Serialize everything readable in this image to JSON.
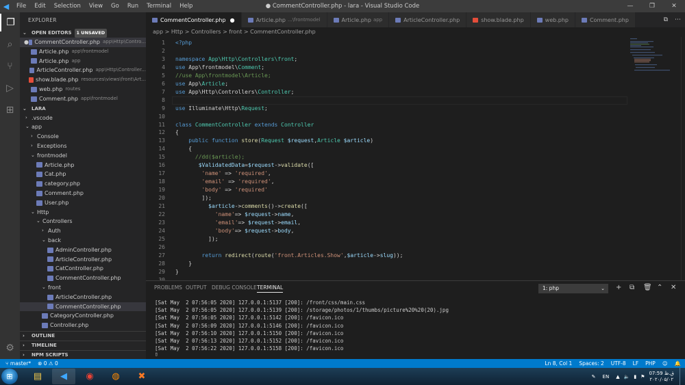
{
  "window": {
    "title": "● CommentController.php - lara - Visual Studio Code",
    "menu": [
      "File",
      "Edit",
      "Selection",
      "View",
      "Go",
      "Run",
      "Terminal",
      "Help"
    ],
    "controls": [
      "—",
      "❐",
      "✕"
    ]
  },
  "sidebar": {
    "header": "EXPLORER",
    "open_editors": {
      "label": "OPEN EDITORS",
      "badge": "1 UNSAVED",
      "items": [
        {
          "name": "CommentController.php",
          "desc": "app\\Http\\Contro...",
          "dirty": true
        },
        {
          "name": "Article.php",
          "desc": "app\\frontmodel"
        },
        {
          "name": "Article.php",
          "desc": "app"
        },
        {
          "name": "ArticleController.php",
          "desc": "app\\Http\\Controller..."
        },
        {
          "name": "show.blade.php",
          "desc": "resources\\views\\front\\Art..."
        },
        {
          "name": "web.php",
          "desc": "routes"
        },
        {
          "name": "Comment.php",
          "desc": "app\\frontmodel"
        }
      ]
    },
    "project": {
      "label": "LARA",
      "tree": [
        {
          "name": ".vscode",
          "depth": 1,
          "type": "folder",
          "open": false
        },
        {
          "name": "app",
          "depth": 1,
          "type": "folder",
          "open": true
        },
        {
          "name": "Console",
          "depth": 2,
          "type": "folder",
          "open": false
        },
        {
          "name": "Exceptions",
          "depth": 2,
          "type": "folder",
          "open": false
        },
        {
          "name": "frontmodel",
          "depth": 2,
          "type": "folder",
          "open": true
        },
        {
          "name": "Article.php",
          "depth": 3,
          "type": "php"
        },
        {
          "name": "Cat.php",
          "depth": 3,
          "type": "php"
        },
        {
          "name": "category.php",
          "depth": 3,
          "type": "php"
        },
        {
          "name": "Comment.php",
          "depth": 3,
          "type": "php"
        },
        {
          "name": "User.php",
          "depth": 3,
          "type": "php"
        },
        {
          "name": "Http",
          "depth": 2,
          "type": "folder",
          "open": true
        },
        {
          "name": "Controllers",
          "depth": 3,
          "type": "folder",
          "open": true
        },
        {
          "name": "Auth",
          "depth": 4,
          "type": "folder",
          "open": false
        },
        {
          "name": "back",
          "depth": 4,
          "type": "folder",
          "open": true
        },
        {
          "name": "AdminController.php",
          "depth": 5,
          "type": "php"
        },
        {
          "name": "ArticleController.php",
          "depth": 5,
          "type": "php"
        },
        {
          "name": "CatController.php",
          "depth": 5,
          "type": "php"
        },
        {
          "name": "CommentController.php",
          "depth": 5,
          "type": "php"
        },
        {
          "name": "front",
          "depth": 4,
          "type": "folder",
          "open": true
        },
        {
          "name": "ArticleController.php",
          "depth": 5,
          "type": "php"
        },
        {
          "name": "CommentController.php",
          "depth": 5,
          "type": "php",
          "selected": true
        },
        {
          "name": "CategoryController.php",
          "depth": 4,
          "type": "php"
        },
        {
          "name": "Controller.php",
          "depth": 4,
          "type": "php"
        }
      ]
    },
    "bottom_sections": [
      "OUTLINE",
      "TIMELINE",
      "NPM SCRIPTS"
    ]
  },
  "tabs": [
    {
      "label": "CommentController.php",
      "dirty": true,
      "active": true
    },
    {
      "label": "Article.php",
      "desc": "...\\frontmodel"
    },
    {
      "label": "Article.php",
      "desc": "app"
    },
    {
      "label": "ArticleController.php"
    },
    {
      "label": "show.blade.php",
      "blade": true
    },
    {
      "label": "web.php"
    },
    {
      "label": "Comment.php"
    }
  ],
  "breadcrumb": "app > Http > Controllers > front > CommentController.php",
  "editor": {
    "cursor_line": 8,
    "lines": [
      {
        "n": 1,
        "t": [
          [
            "kw",
            "<?php"
          ]
        ]
      },
      {
        "n": 2,
        "t": []
      },
      {
        "n": 3,
        "t": [
          [
            "kw",
            "namespace "
          ],
          [
            "ns",
            "App\\Http\\Controllers\\front"
          ],
          [
            "",
            "; "
          ]
        ]
      },
      {
        "n": 4,
        "t": [
          [
            "kw",
            "use "
          ],
          [
            "",
            "App\\frontmodel\\"
          ],
          [
            "ns",
            "Comment"
          ],
          [
            "",
            ";"
          ]
        ]
      },
      {
        "n": 5,
        "t": [
          [
            "cm",
            "//use App\\frontmodel\\Article;"
          ]
        ]
      },
      {
        "n": 6,
        "t": [
          [
            "kw",
            "use "
          ],
          [
            "",
            "App\\"
          ],
          [
            "ns",
            "Article"
          ],
          [
            "",
            ";"
          ]
        ]
      },
      {
        "n": 7,
        "t": [
          [
            "kw",
            "use "
          ],
          [
            "",
            "App\\Http\\Controllers\\"
          ],
          [
            "ns",
            "Controller"
          ],
          [
            "",
            ";"
          ]
        ]
      },
      {
        "n": 8,
        "t": []
      },
      {
        "n": 9,
        "t": [
          [
            "kw",
            "use "
          ],
          [
            "",
            "Illuminate\\Http\\"
          ],
          [
            "ns",
            "Request"
          ],
          [
            "",
            ";"
          ]
        ]
      },
      {
        "n": 10,
        "t": []
      },
      {
        "n": 11,
        "t": [
          [
            "kw",
            "class "
          ],
          [
            "ns",
            "CommentController "
          ],
          [
            "kw",
            "extends "
          ],
          [
            "ns",
            "Controller"
          ]
        ]
      },
      {
        "n": 12,
        "t": [
          [
            "",
            "{"
          ]
        ]
      },
      {
        "n": 13,
        "t": [
          [
            "",
            "    "
          ],
          [
            "kw",
            "public function "
          ],
          [
            "fn",
            "store"
          ],
          [
            "",
            "("
          ],
          [
            "ns",
            "Request "
          ],
          [
            "vr",
            "$request"
          ],
          [
            "",
            ","
          ],
          [
            "ns",
            "Article "
          ],
          [
            "vr",
            "$article"
          ],
          [
            "",
            ")"
          ]
        ]
      },
      {
        "n": 14,
        "t": [
          [
            "",
            "    {"
          ]
        ]
      },
      {
        "n": 15,
        "t": [
          [
            "",
            "      "
          ],
          [
            "cm",
            "//dd($article);"
          ]
        ]
      },
      {
        "n": 16,
        "t": [
          [
            "",
            "       "
          ],
          [
            "vr",
            "$ValidatedData"
          ],
          [
            "",
            "="
          ],
          [
            "vr",
            "$request"
          ],
          [
            "",
            "->"
          ],
          [
            "fn",
            "validate"
          ],
          [
            "",
            "(["
          ]
        ]
      },
      {
        "n": 17,
        "t": [
          [
            "",
            "        "
          ],
          [
            "st",
            "'name'"
          ],
          [
            "",
            " => "
          ],
          [
            "st",
            "'required'"
          ],
          [
            "",
            ","
          ]
        ]
      },
      {
        "n": 18,
        "t": [
          [
            "",
            "        "
          ],
          [
            "st",
            "'email'"
          ],
          [
            "",
            " => "
          ],
          [
            "st",
            "'required'"
          ],
          [
            "",
            ","
          ]
        ]
      },
      {
        "n": 19,
        "t": [
          [
            "",
            "        "
          ],
          [
            "st",
            "'body'"
          ],
          [
            "",
            " => "
          ],
          [
            "st",
            "'required'"
          ]
        ]
      },
      {
        "n": 20,
        "t": [
          [
            "",
            "        ]);"
          ]
        ]
      },
      {
        "n": 21,
        "t": [
          [
            "",
            "          "
          ],
          [
            "vr",
            "$article"
          ],
          [
            "",
            "->"
          ],
          [
            "fn",
            "comments"
          ],
          [
            "",
            "()->"
          ],
          [
            "fn",
            "create"
          ],
          [
            "",
            "(["
          ]
        ]
      },
      {
        "n": 22,
        "t": [
          [
            "",
            "            "
          ],
          [
            "st",
            "'name'"
          ],
          [
            "",
            "=> "
          ],
          [
            "vr",
            "$request"
          ],
          [
            "",
            "->"
          ],
          [
            "vr",
            "name"
          ],
          [
            "",
            ","
          ]
        ]
      },
      {
        "n": 23,
        "t": [
          [
            "",
            "            "
          ],
          [
            "st",
            "'email'"
          ],
          [
            "",
            "=> "
          ],
          [
            "vr",
            "$request"
          ],
          [
            "",
            "->"
          ],
          [
            "vr",
            "email"
          ],
          [
            "",
            ","
          ]
        ]
      },
      {
        "n": 24,
        "t": [
          [
            "",
            "            "
          ],
          [
            "st",
            "'body'"
          ],
          [
            "",
            "=> "
          ],
          [
            "vr",
            "$request"
          ],
          [
            "",
            "->"
          ],
          [
            "vr",
            "body"
          ],
          [
            "",
            ","
          ]
        ]
      },
      {
        "n": 25,
        "t": [
          [
            "",
            "          ]);"
          ]
        ]
      },
      {
        "n": 26,
        "t": []
      },
      {
        "n": 27,
        "t": [
          [
            "",
            "        "
          ],
          [
            "kw",
            "return "
          ],
          [
            "fn",
            "redirect"
          ],
          [
            "",
            "("
          ],
          [
            "fn",
            "route"
          ],
          [
            "",
            "("
          ],
          [
            "st",
            "'front.Articles.Show'"
          ],
          [
            "",
            ","
          ],
          [
            "vr",
            "$article"
          ],
          [
            "",
            "->"
          ],
          [
            "vr",
            "slug"
          ],
          [
            "",
            "));"
          ]
        ]
      },
      {
        "n": 28,
        "t": [
          [
            "",
            "    }"
          ]
        ]
      },
      {
        "n": 29,
        "t": [
          [
            "",
            "}"
          ]
        ]
      },
      {
        "n": 30,
        "t": []
      }
    ]
  },
  "panel": {
    "tabs": [
      "PROBLEMS",
      "OUTPUT",
      "DEBUG CONSOLE",
      "TERMINAL"
    ],
    "active_tab": "TERMINAL",
    "terminal_select": "1: php",
    "terminal_lines": [
      "[Sat May  2 07:56:05 2020] 127.0.0.1:5137 [200]: /front/css/main.css",
      "[Sat May  2 07:56:05 2020] 127.0.0.1:5139 [200]: /storage/photos/1/thumbs/picture%20%20(20).jpg",
      "[Sat May  2 07:56:05 2020] 127.0.0.1:5142 [200]: /favicon.ico",
      "[Sat May  2 07:56:09 2020] 127.0.0.1:5146 [200]: /favicon.ico",
      "[Sat May  2 07:56:10 2020] 127.0.0.1:5150 [200]: /favicon.ico",
      "[Sat May  2 07:56:13 2020] 127.0.0.1:5152 [200]: /favicon.ico",
      "[Sat May  2 07:56:22 2020] 127.0.0.1:5158 [200]: /favicon.ico"
    ]
  },
  "statusbar": {
    "branch": "master*",
    "problems": "⊗ 0 ⚠ 0",
    "position": "Ln 8, Col 1",
    "spaces": "Spaces: 2",
    "encoding": "UTF-8",
    "eol": "LF",
    "language": "PHP"
  },
  "taskbar": {
    "lang": "EN",
    "time": "07:59 ق.ظ",
    "date": "۲۰۲۰/۰۵/۰۲"
  },
  "colors": {
    "accent": "#007acc",
    "keyword": "#569cd6",
    "type": "#4ec9b0",
    "string": "#ce9178",
    "comment": "#6a9955"
  }
}
